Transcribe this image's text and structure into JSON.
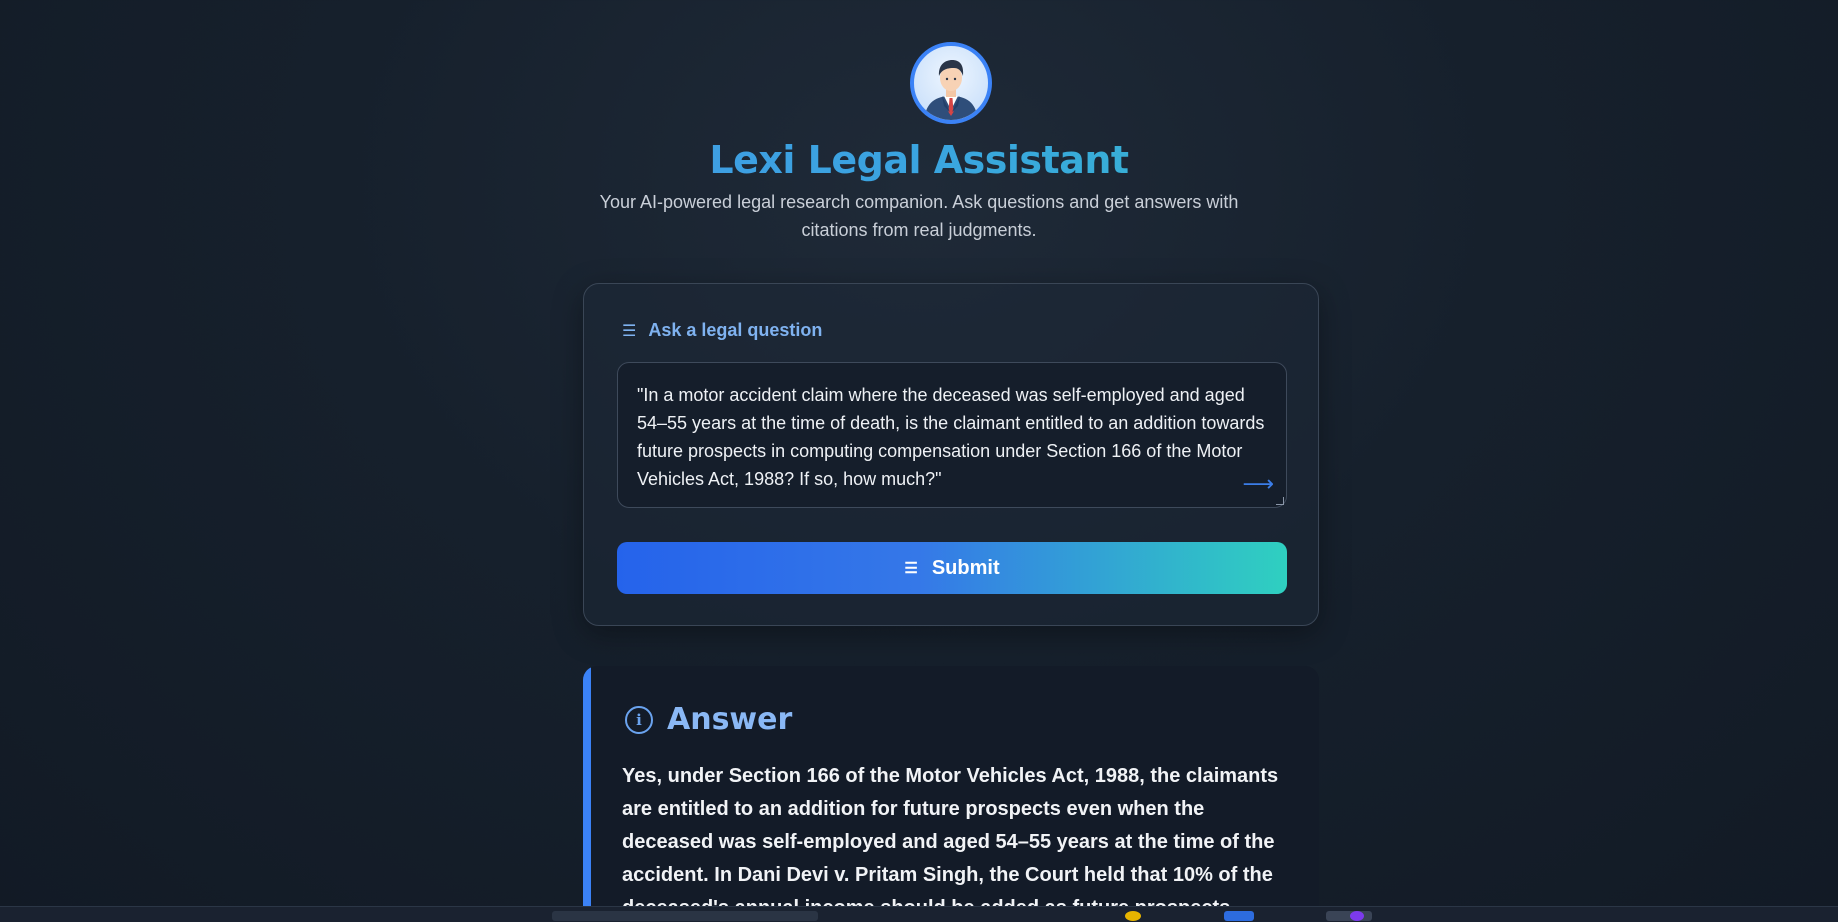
{
  "app": {
    "title": "Lexi Legal Assistant",
    "subtitle": "Your AI-powered legal research companion. Ask questions and get answers with citations from real judgments.",
    "avatar_icon": "lawyer-avatar-icon"
  },
  "question_card": {
    "label": "Ask a legal question",
    "label_icon": "lines-icon",
    "input_value": "\"In a motor accident claim where the deceased was self-employed and aged 54–55 years at the time of death, is the claimant entitled to an addition towards future prospects in computing compensation under Section 166 of the Motor Vehicles Act, 1988? If so, how much?\"",
    "send_icon": "arrow-right-icon",
    "submit_label": "Submit"
  },
  "answer": {
    "heading": "Answer",
    "icon": "info-icon",
    "text": "Yes, under Section 166 of the Motor Vehicles Act, 1988, the claimants are entitled to an addition for future prospects even when the deceased was self-employed and aged 54–55 years at the time of the accident. In Dani Devi v. Pritam Singh, the Court held that 10% of the deceased's annual income should be added as future prospects."
  },
  "colors": {
    "accent_blue": "#3b82f6",
    "accent_teal": "#2fd0c0",
    "background": "#16202c"
  }
}
